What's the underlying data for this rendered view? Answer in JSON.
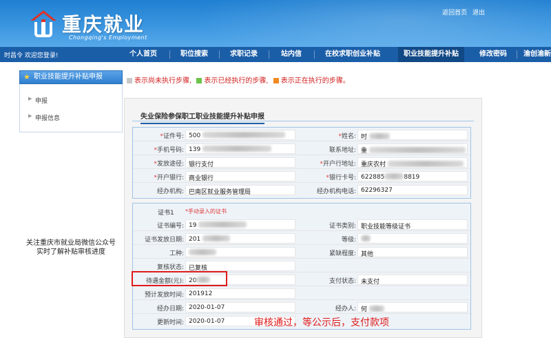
{
  "header": {
    "site_title": "重庆就业",
    "site_subtitle": "Chongqing's Employment",
    "links": [
      "返回首页",
      "退出"
    ]
  },
  "nav": {
    "greeting": "时昌令  欢迎您登录!",
    "items": [
      "个人首页",
      "职位搜索",
      "求职记录",
      "站内信",
      "在校求职创业补贴",
      "职业技能提升补贴",
      "修改密码",
      "渝创渝新"
    ],
    "active_index": 5
  },
  "sidebar": {
    "header": "职业技能提升补贴申报",
    "items": [
      "申报",
      "申报信息"
    ],
    "notice_line1": "关注重庆市就业局微信公众号",
    "notice_line2": "实时了解补贴审核进度"
  },
  "legend": {
    "grey_text": "表示尚未执行步骤,",
    "green_text": "表示已经执行的步骤,",
    "orange_text": "表示正在执行的步骤。",
    "grey_color": "#c8c8c8",
    "green_color": "#6cc24a",
    "orange_color": "#f08a24"
  },
  "form": {
    "tab_title": "失业保险参保职工职业技能提升补贴申报",
    "personal": {
      "id_label": "证件号:",
      "id_value": "500",
      "name_label": "姓名:",
      "name_value": "时",
      "phone_label": "手机号码:",
      "phone_value": "139",
      "address_label": "联系地址:",
      "address_value": "重",
      "pay_method_label": "发放途径:",
      "pay_method_value": "银行支付",
      "open_bank_label": "开户行地址:",
      "open_bank_value": "重庆农村",
      "bank_label": "开户银行:",
      "bank_value": "商业银行",
      "card_label": "银行卡号:",
      "card_value_prefix": "622885",
      "card_value_suffix": "8819",
      "agency_label": "经办机构:",
      "agency_value": "巴南区就业服务管理局",
      "agency_phone_label": "经办机构电话:",
      "agency_phone_value": "62296327"
    },
    "certificate": {
      "title": "证书1",
      "note": "手动录入的证书",
      "cert_no_label": "证书编号:",
      "cert_no_value": "19",
      "cert_type_label": "证书类别:",
      "cert_type_value": "职业技能等级证书",
      "issue_date_label": "证书发放日期:",
      "issue_date_value": "201",
      "level_label": "等级:",
      "level_value": "",
      "job_label": "工种:",
      "job_value": "",
      "urgency_label": "紧缺程度:",
      "urgency_value": "其他",
      "review_label": "复核状态:",
      "review_value": "已复核",
      "amount_label": "待遇金额(元):",
      "amount_value": "20",
      "pay_status_label": "支付状态:",
      "pay_status_value": "未支付",
      "expected_label": "预计发放时间:",
      "expected_value": "201912",
      "handle_date_label": "经办日期:",
      "handle_date_value": "2020-01-07",
      "handler_label": "经办人:",
      "handler_value": "何",
      "update_label": "更新时间:",
      "update_value": "2020-01-07"
    }
  },
  "annotation": "审核通过，等公示后，支付款项"
}
